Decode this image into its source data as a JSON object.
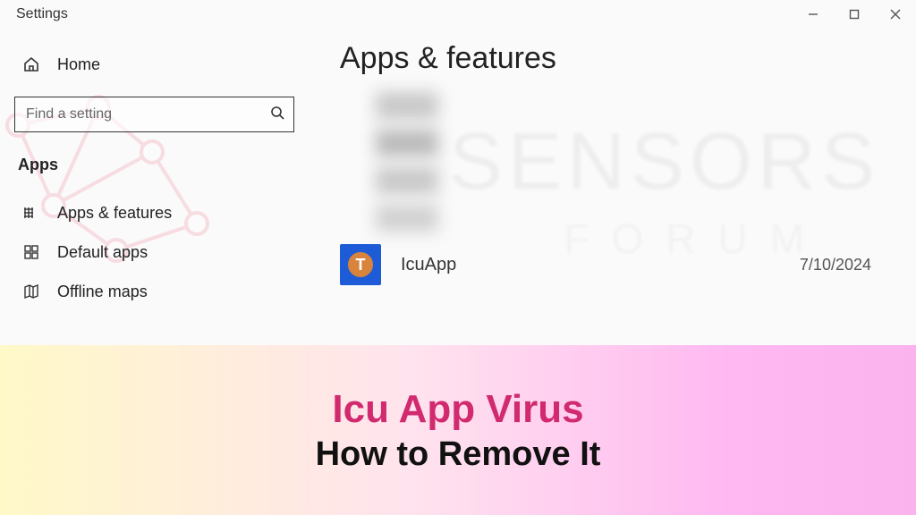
{
  "window": {
    "title": "Settings"
  },
  "sidebar": {
    "home_label": "Home",
    "search_placeholder": "Find a setting",
    "section_label": "Apps",
    "items": [
      {
        "label": "Apps & features"
      },
      {
        "label": "Default apps"
      },
      {
        "label": "Offline maps"
      }
    ]
  },
  "main": {
    "title": "Apps & features",
    "app": {
      "name": "IcuApp",
      "date": "7/10/2024",
      "icon_letter": "T"
    }
  },
  "watermark": {
    "line1": "SENSORS",
    "line2": "FORUM"
  },
  "banner": {
    "line1": "Icu App Virus",
    "line2": "How to Remove It"
  }
}
